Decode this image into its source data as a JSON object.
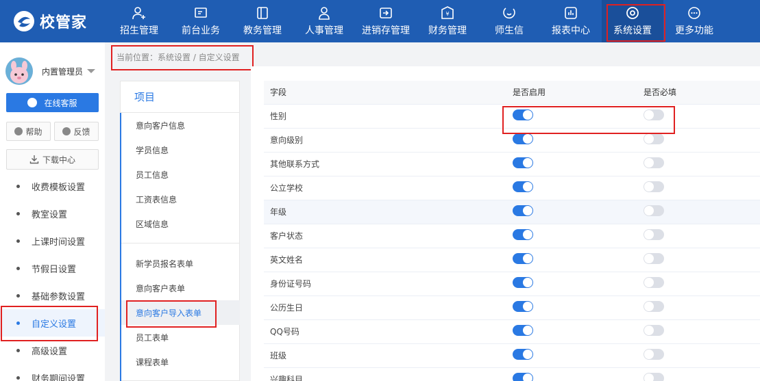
{
  "app": {
    "logo_text": "校管家"
  },
  "nav": [
    {
      "label": "招生管理",
      "icon": "person-add-icon"
    },
    {
      "label": "前台业务",
      "icon": "monitor-icon"
    },
    {
      "label": "教务管理",
      "icon": "book-icon"
    },
    {
      "label": "人事管理",
      "icon": "person-icon"
    },
    {
      "label": "进销存管理",
      "icon": "inventory-icon"
    },
    {
      "label": "财务管理",
      "icon": "yen-icon"
    },
    {
      "label": "师生信",
      "icon": "message-icon"
    },
    {
      "label": "报表中心",
      "icon": "report-icon"
    },
    {
      "label": "系统设置",
      "icon": "gear-icon",
      "active": true
    },
    {
      "label": "更多功能",
      "icon": "more-icon"
    }
  ],
  "sidebar": {
    "user_name": "内置管理员",
    "service_label": "在线客服",
    "help_label": "帮助",
    "feedback_label": "反馈",
    "download_label": "下载中心",
    "items": [
      {
        "label": "收费模板设置"
      },
      {
        "label": "教室设置"
      },
      {
        "label": "上课时间设置"
      },
      {
        "label": "节假日设置"
      },
      {
        "label": "基础参数设置"
      },
      {
        "label": "自定义设置",
        "active": true
      },
      {
        "label": "高级设置"
      },
      {
        "label": "财务期间设置"
      }
    ]
  },
  "breadcrumb": "当前位置：系统设置 / 自定义设置",
  "panel": {
    "title": "项目",
    "group1": [
      "意向客户信息",
      "学员信息",
      "员工信息",
      "工资表信息",
      "区域信息"
    ],
    "group2": [
      "新学员报名表单",
      "意向客户表单",
      "意向客户导入表单",
      "员工表单",
      "课程表单"
    ],
    "active": "意向客户导入表单"
  },
  "table": {
    "headers": [
      "字段",
      "是否启用",
      "是否必填"
    ],
    "rows": [
      {
        "field": "性别",
        "enabled": true,
        "required": false
      },
      {
        "field": "意向级别",
        "enabled": true,
        "required": false
      },
      {
        "field": "其他联系方式",
        "enabled": true,
        "required": false
      },
      {
        "field": "公立学校",
        "enabled": true,
        "required": false
      },
      {
        "field": "年级",
        "enabled": true,
        "required": false
      },
      {
        "field": "客户状态",
        "enabled": true,
        "required": false
      },
      {
        "field": "英文姓名",
        "enabled": true,
        "required": false
      },
      {
        "field": "身份证号码",
        "enabled": true,
        "required": false
      },
      {
        "field": "公历生日",
        "enabled": true,
        "required": false
      },
      {
        "field": "QQ号码",
        "enabled": true,
        "required": false
      },
      {
        "field": "班级",
        "enabled": true,
        "required": false
      },
      {
        "field": "兴趣科目",
        "enabled": true,
        "required": false
      }
    ]
  },
  "colors": {
    "brand": "#1f5db3",
    "accent": "#2a79e3",
    "highlight": "#e02020"
  }
}
